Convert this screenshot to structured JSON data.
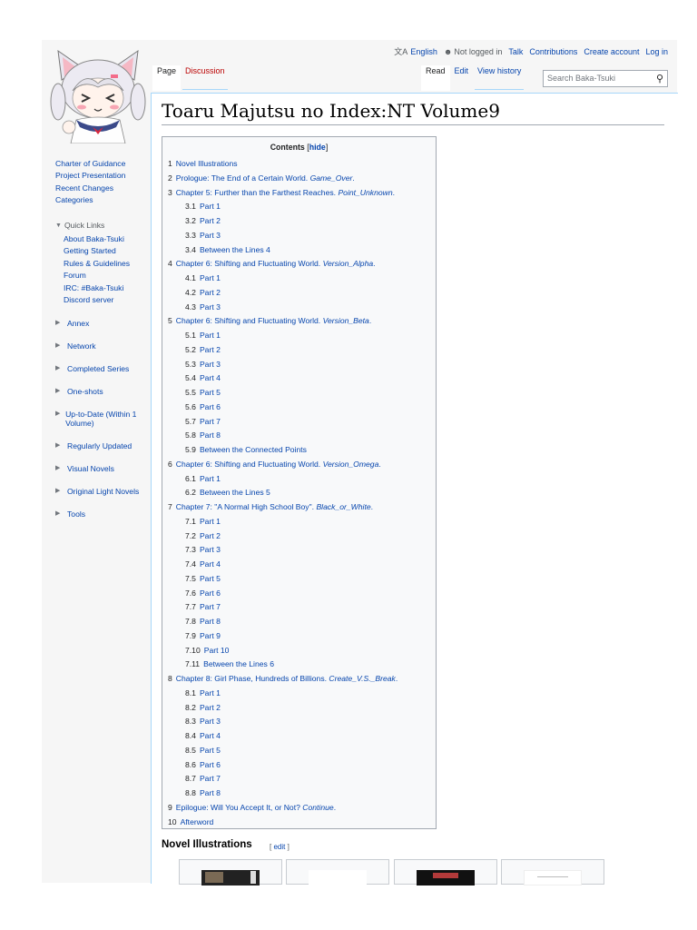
{
  "personal_bar": {
    "language": "English",
    "not_logged_in": "Not logged in",
    "talk": "Talk",
    "contributions": "Contributions",
    "create_account": "Create account",
    "log_in": "Log in"
  },
  "tabs": {
    "page": "Page",
    "discussion": "Discussion",
    "read": "Read",
    "edit": "Edit",
    "view_history": "View history"
  },
  "search": {
    "placeholder": "Search Baka-Tsuki"
  },
  "title": "Toaru Majutsu no Index:NT Volume9",
  "sidebar": {
    "nav": [
      "Charter of Guidance",
      "Project Presentation",
      "Recent Changes",
      "Categories"
    ],
    "quick_links_label": "Quick Links",
    "quick_links": [
      "About Baka-Tsuki",
      "Getting Started",
      "Rules & Guidelines",
      "Forum",
      "IRC: #Baka-Tsuki",
      "Discord server"
    ],
    "groups": [
      "Annex",
      "Network",
      "Completed Series",
      "One-shots",
      "Up-to-Date (Within 1 Volume)",
      "Regularly Updated",
      "Visual Novels",
      "Original Light Novels",
      "Tools"
    ]
  },
  "toc": {
    "title": "Contents",
    "hide": "hide",
    "entries": [
      {
        "num": "1",
        "text": "Novel Illustrations",
        "level": 1
      },
      {
        "num": "2",
        "text": "Prologue: The End of a Certain World. ",
        "italic": "Game_Over",
        "tail": ".",
        "level": 1
      },
      {
        "num": "3",
        "text": "Chapter 5: Further than the Farthest Reaches. ",
        "italic": "Point_Unknown",
        "tail": ".",
        "level": 1
      },
      {
        "num": "3.1",
        "text": "Part 1",
        "level": 2
      },
      {
        "num": "3.2",
        "text": "Part 2",
        "level": 2
      },
      {
        "num": "3.3",
        "text": "Part 3",
        "level": 2
      },
      {
        "num": "3.4",
        "text": "Between the Lines 4",
        "level": 2
      },
      {
        "num": "4",
        "text": "Chapter 6: Shifting and Fluctuating World. ",
        "italic": "Version_Alpha",
        "tail": ".",
        "level": 1
      },
      {
        "num": "4.1",
        "text": "Part 1",
        "level": 2
      },
      {
        "num": "4.2",
        "text": "Part 2",
        "level": 2
      },
      {
        "num": "4.3",
        "text": "Part 3",
        "level": 2
      },
      {
        "num": "5",
        "text": "Chapter 6: Shifting and Fluctuating World. ",
        "italic": "Version_Beta",
        "tail": ".",
        "level": 1
      },
      {
        "num": "5.1",
        "text": "Part 1",
        "level": 2
      },
      {
        "num": "5.2",
        "text": "Part 2",
        "level": 2
      },
      {
        "num": "5.3",
        "text": "Part 3",
        "level": 2
      },
      {
        "num": "5.4",
        "text": "Part 4",
        "level": 2
      },
      {
        "num": "5.5",
        "text": "Part 5",
        "level": 2
      },
      {
        "num": "5.6",
        "text": "Part 6",
        "level": 2
      },
      {
        "num": "5.7",
        "text": "Part 7",
        "level": 2
      },
      {
        "num": "5.8",
        "text": "Part 8",
        "level": 2
      },
      {
        "num": "5.9",
        "text": "Between the Connected Points",
        "level": 2
      },
      {
        "num": "6",
        "text": "Chapter 6: Shifting and Fluctuating World. ",
        "italic": "Version_Omega",
        "tail": ".",
        "level": 1
      },
      {
        "num": "6.1",
        "text": "Part 1",
        "level": 2
      },
      {
        "num": "6.2",
        "text": "Between the Lines 5",
        "level": 2
      },
      {
        "num": "7",
        "text": "Chapter 7: \"A Normal High School Boy\". ",
        "italic": "Black_or_White",
        "tail": ".",
        "level": 1
      },
      {
        "num": "7.1",
        "text": "Part 1",
        "level": 2
      },
      {
        "num": "7.2",
        "text": "Part 2",
        "level": 2
      },
      {
        "num": "7.3",
        "text": "Part 3",
        "level": 2
      },
      {
        "num": "7.4",
        "text": "Part 4",
        "level": 2
      },
      {
        "num": "7.5",
        "text": "Part 5",
        "level": 2
      },
      {
        "num": "7.6",
        "text": "Part 6",
        "level": 2
      },
      {
        "num": "7.7",
        "text": "Part 7",
        "level": 2
      },
      {
        "num": "7.8",
        "text": "Part 8",
        "level": 2
      },
      {
        "num": "7.9",
        "text": "Part 9",
        "level": 2
      },
      {
        "num": "7.10",
        "text": "Part 10",
        "level": 2
      },
      {
        "num": "7.11",
        "text": "Between the Lines 6",
        "level": 2
      },
      {
        "num": "8",
        "text": "Chapter 8: Girl Phase, Hundreds of Billions. ",
        "italic": "Create_V.S._Break",
        "tail": ".",
        "level": 1
      },
      {
        "num": "8.1",
        "text": "Part 1",
        "level": 2
      },
      {
        "num": "8.2",
        "text": "Part 2",
        "level": 2
      },
      {
        "num": "8.3",
        "text": "Part 3",
        "level": 2
      },
      {
        "num": "8.4",
        "text": "Part 4",
        "level": 2
      },
      {
        "num": "8.5",
        "text": "Part 5",
        "level": 2
      },
      {
        "num": "8.6",
        "text": "Part 6",
        "level": 2
      },
      {
        "num": "8.7",
        "text": "Part 7",
        "level": 2
      },
      {
        "num": "8.8",
        "text": "Part 8",
        "level": 2
      },
      {
        "num": "9",
        "text": "Epilogue: Will You Accept It, or Not? ",
        "italic": "Continue",
        "tail": ".",
        "level": 1
      },
      {
        "num": "10",
        "text": "Afterword",
        "level": 1
      }
    ]
  },
  "section": {
    "heading": "Novel Illustrations",
    "edit_open": "[ ",
    "edit": "edit",
    "edit_close": " ]"
  },
  "colors": {
    "link": "#0645ad",
    "border": "#a7d7f9",
    "discussion": "#ba0000"
  }
}
